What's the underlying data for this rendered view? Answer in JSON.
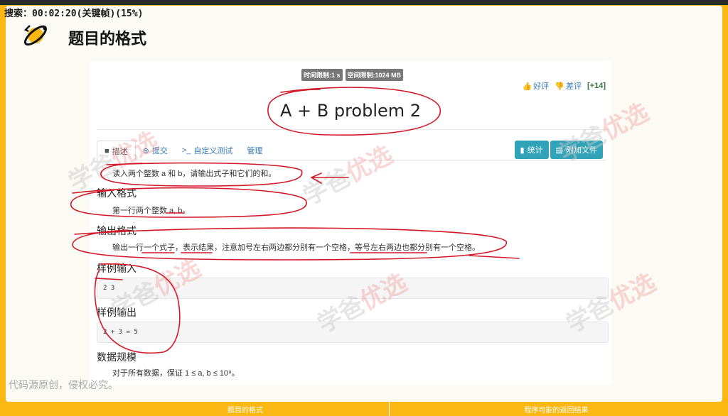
{
  "status": {
    "search": "搜索：00:02:20(关键帧)(15%)"
  },
  "slide": {
    "title": "题目的格式"
  },
  "limits": {
    "time": "时间限制:1 s",
    "memory": "空间限制:1024 MB"
  },
  "votes": {
    "good": "好评",
    "bad": "差评",
    "score": "[+14]"
  },
  "problem": {
    "title": "A + B problem 2"
  },
  "tabs": [
    {
      "label": "描述",
      "icon": "book-icon"
    },
    {
      "label": "提交",
      "icon": "upload-icon"
    },
    {
      "label": "自定义测试",
      "icon": "terminal-icon"
    },
    {
      "label": "管理",
      "icon": ""
    }
  ],
  "actions": {
    "stats": "统计",
    "attachments": "附加文件"
  },
  "content": {
    "description": "读入两个整数 a 和 b，请输出式子和它们的和。",
    "input_title": "输入格式",
    "input_text": "第一行两个整数 a, b。",
    "output_title": "输出格式",
    "output_text": "输出一行一个式子，表示结果，注意加号左右两边都分别有一个空格，等号左右两边也都分别有一个空格。",
    "sample_input_title": "样例输入",
    "sample_input": "2 3",
    "sample_output_title": "样例输出",
    "sample_output": "2 + 3 = 5",
    "constraints_title": "数据规模",
    "constraints_text": "对于所有数据，保证 1 ≤ a, b ≤ 10⁹。"
  },
  "watermark": {
    "text1": "学爸",
    "text2": "优选"
  },
  "notice": "代码源原创，侵权必究。",
  "bottom": {
    "left": "题目的格式",
    "right": "程序可能的返回结果"
  },
  "colors": {
    "accent_orange": "#fbb814",
    "action_teal": "#31a3b8",
    "ink_red": "#d21a2a"
  }
}
